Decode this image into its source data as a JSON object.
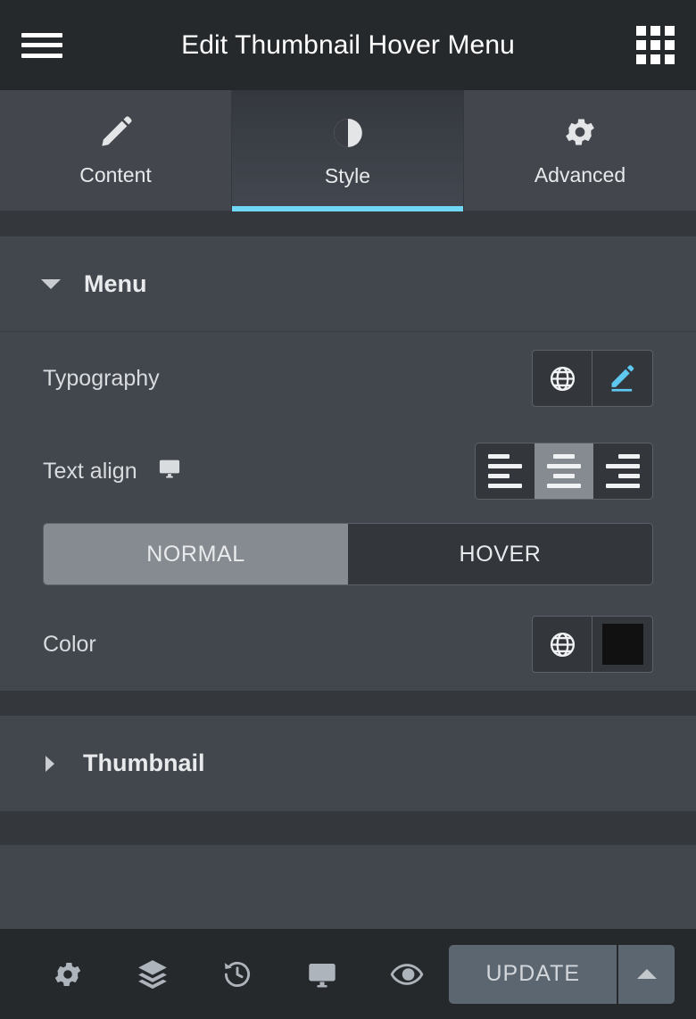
{
  "header": {
    "title": "Edit Thumbnail Hover Menu",
    "menu_icon": "hamburger-icon",
    "apps_icon": "grid-apps-icon"
  },
  "tabs": [
    {
      "label": "Content",
      "icon": "pencil-icon",
      "active": false
    },
    {
      "label": "Style",
      "icon": "contrast-icon",
      "active": true
    },
    {
      "label": "Advanced",
      "icon": "gear-icon",
      "active": false
    }
  ],
  "sections": [
    {
      "title": "Menu",
      "expanded": true
    },
    {
      "title": "Thumbnail",
      "expanded": false
    }
  ],
  "controls": {
    "typography": {
      "label": "Typography",
      "globe_icon": "globe-icon",
      "edit_icon": "pencil-edit-icon"
    },
    "text_align": {
      "label": "Text align",
      "device_icon": "desktop-icon",
      "options": [
        "left",
        "center",
        "right"
      ],
      "selected": "center"
    },
    "state_tabs": {
      "normal": "NORMAL",
      "hover": "HOVER",
      "selected": "NORMAL"
    },
    "color": {
      "label": "Color",
      "globe_icon": "globe-icon",
      "value": "#111111"
    }
  },
  "footer": {
    "icons": [
      "settings-gear-icon",
      "layers-icon",
      "history-icon",
      "responsive-monitor-icon",
      "preview-eye-icon"
    ],
    "update_label": "UPDATE",
    "dropdown_icon": "chevron-up-icon"
  },
  "theme": {
    "accent": "#71d7f7",
    "panel_bg": "#42464d",
    "header_bg": "#26292c",
    "control_bg": "#33373c",
    "active_gray": "#868b92",
    "update_bg": "#5b6670"
  }
}
